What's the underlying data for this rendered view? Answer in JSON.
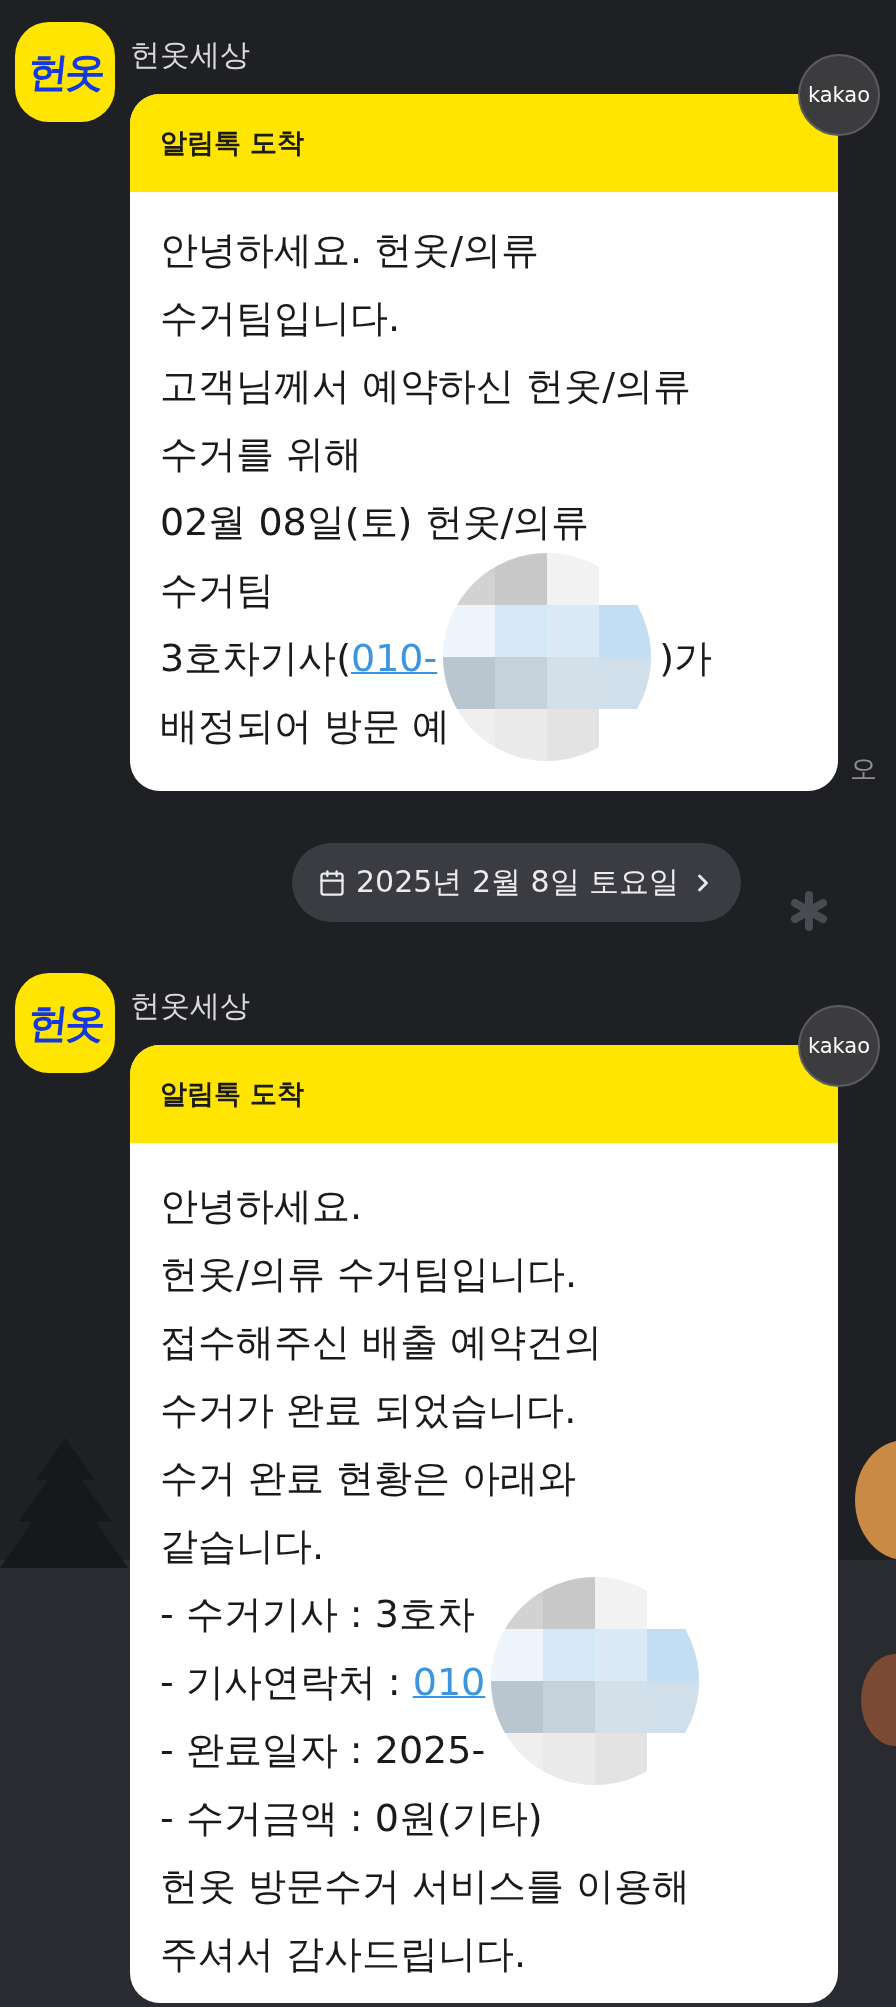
{
  "chat": [
    {
      "kind": "message",
      "sender": "헌옷세상",
      "avatar_text": "헌옷",
      "badge": "kakao",
      "header": "알림톡 도착",
      "time": "오",
      "lines": [
        [
          {
            "text": "안녕하세요. 헌옷/의류"
          }
        ],
        [
          {
            "text": "수거팀입니다."
          }
        ],
        [
          {
            "text": "고객님께서  예약하신 헌옷/의류"
          }
        ],
        [
          {
            "text": "수거를 위해"
          }
        ],
        [
          {
            "text": "02월 08일(토) 헌옷/의류"
          }
        ],
        [
          {
            "text": "수거팀"
          }
        ],
        [
          {
            "text": "3호차기사("
          },
          {
            "kind": "link",
            "text": "010-"
          },
          {
            "kind": "hidden"
          },
          {
            "text": ")가"
          }
        ],
        [
          {
            "text": "배정되어 방문 예"
          }
        ]
      ]
    },
    {
      "kind": "date",
      "label": "2025년 2월 8일 토요일"
    },
    {
      "kind": "message",
      "sender": "헌옷세상",
      "avatar_text": "헌옷",
      "badge": "kakao",
      "header": "알림톡 도착",
      "lines": [
        [
          {
            "text": "안녕하세요."
          }
        ],
        [
          {
            "text": "헌옷/의류 수거팀입니다."
          }
        ],
        [
          {
            "text": "접수해주신 배출 예약건의"
          }
        ],
        [
          {
            "text": "수거가 완료 되었습니다."
          }
        ],
        [
          {
            "text": "수거 완료 현황은 아래와"
          }
        ],
        [
          {
            "text": "같습니다."
          }
        ],
        [
          {
            "text": "- 수거기사 : 3호차"
          }
        ],
        [
          {
            "text": "- 기사연락처 : "
          },
          {
            "kind": "link",
            "text": "010"
          },
          {
            "kind": "hidden"
          }
        ],
        [
          {
            "text": "- 완료일자 : 2025-"
          }
        ],
        [
          {
            "text": "- 수거금액 : 0원(기타)"
          }
        ],
        [
          {
            "text": "헌옷 방문수거 서비스를 이용해"
          }
        ],
        [
          {
            "text": "주셔서 감사드립니다."
          }
        ]
      ]
    }
  ]
}
